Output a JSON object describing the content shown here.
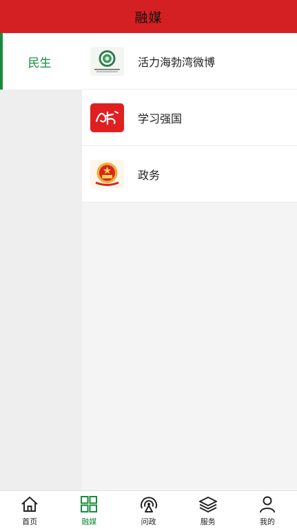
{
  "header": {
    "title": "融媒",
    "bg_color": "#d42022"
  },
  "sidebar": {
    "items": [
      {
        "label": "民生",
        "active": true
      }
    ],
    "accent_color": "#148c3c"
  },
  "list": {
    "items": [
      {
        "label": "活力海勃湾微博",
        "icon": "weibo-emblem-icon"
      },
      {
        "label": "学习强国",
        "icon": "xuexi-qiangguo-icon"
      },
      {
        "label": "政务",
        "icon": "national-emblem-icon"
      }
    ]
  },
  "tabbar": {
    "items": [
      {
        "label": "首页",
        "icon": "home-icon",
        "active": false
      },
      {
        "label": "融媒",
        "icon": "grid-icon",
        "active": true
      },
      {
        "label": "问政",
        "icon": "broadcast-icon",
        "active": false
      },
      {
        "label": "服务",
        "icon": "layers-icon",
        "active": false
      },
      {
        "label": "我的",
        "icon": "user-icon",
        "active": false
      }
    ],
    "active_color": "#148c3c"
  }
}
